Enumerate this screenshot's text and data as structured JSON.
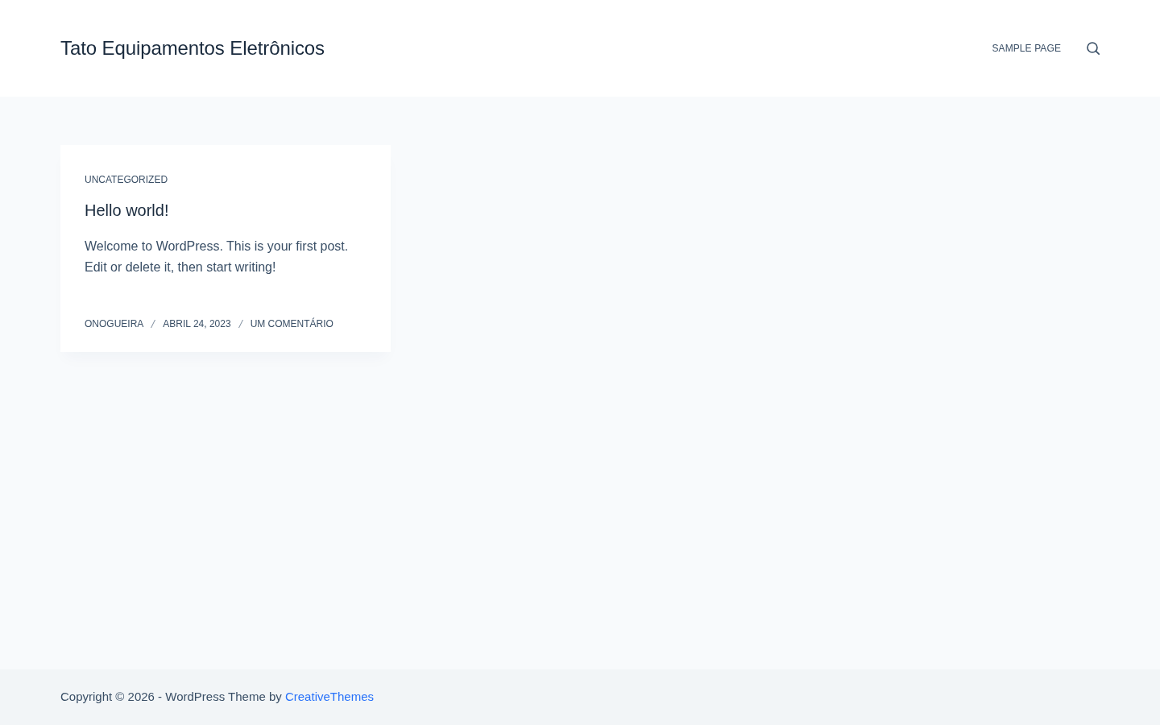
{
  "header": {
    "site_title": "Tato Equipamentos Eletrônicos",
    "nav": [
      {
        "label": "SAMPLE PAGE"
      }
    ]
  },
  "posts": [
    {
      "category": "UNCATEGORIZED",
      "title": "Hello world!",
      "excerpt": "Welcome to WordPress. This is your first post. Edit or delete it, then start writing!",
      "meta": [
        "ONOGUEIRA",
        "ABRIL 24, 2023",
        "UM COMENTÁRIO"
      ]
    }
  ],
  "footer": {
    "text": "Copyright © 2026 - WordPress Theme by",
    "link": "CreativeThemes"
  }
}
